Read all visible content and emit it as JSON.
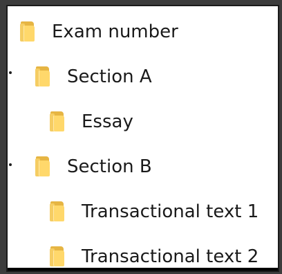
{
  "tree": {
    "items": [
      {
        "label": "Exam number",
        "icon": "folder-icon"
      },
      {
        "label": "Section A",
        "icon": "folder-icon"
      },
      {
        "label": "Essay",
        "icon": "folder-icon"
      },
      {
        "label": "Section B",
        "icon": "folder-icon"
      },
      {
        "label": "Transactional text 1",
        "icon": "folder-icon"
      },
      {
        "label": "Transactional text 2",
        "icon": "folder-icon"
      }
    ]
  },
  "colors": {
    "background": "#3c3c3c",
    "panel": "#ffffff",
    "folder": "#e6b543"
  }
}
